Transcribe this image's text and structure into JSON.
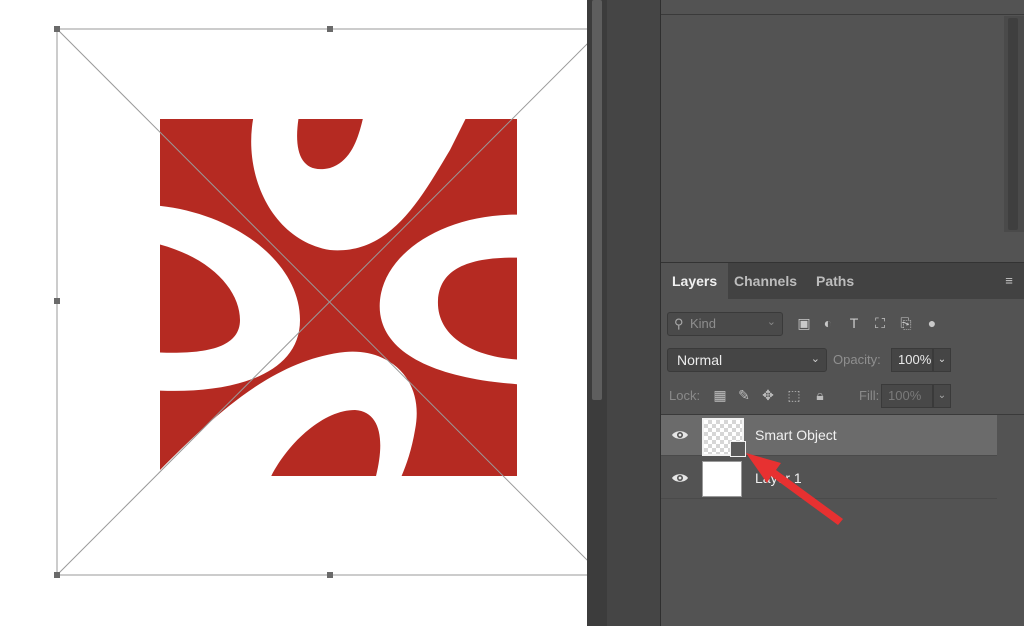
{
  "colors": {
    "artwork_red": "#b52a22",
    "annotation_arrow": "#e73131",
    "panel_bg": "#535353",
    "selected_row": "#6b6b6b"
  },
  "canvas": {
    "artwork": "red square with white abstract curved shapes",
    "transform_box": "free-transform bounding box with handles"
  },
  "layers_panel": {
    "tabs": [
      {
        "label": "Layers",
        "active": true
      },
      {
        "label": "Channels",
        "active": false
      },
      {
        "label": "Paths",
        "active": false
      }
    ],
    "menu_icon": "hamburger-icon",
    "filter": {
      "placeholder": "Kind",
      "icons": [
        "image-filter-icon",
        "adjustment-filter-icon",
        "type-filter-icon",
        "shape-filter-icon",
        "smart-object-filter-icon",
        "toggle-filter-icon"
      ]
    },
    "blend_mode": "Normal",
    "opacity_label": "Opacity:",
    "opacity_value": "100%",
    "lock_label": "Lock:",
    "lock_icons": [
      "lock-transparent-icon",
      "lock-image-icon",
      "lock-position-icon",
      "lock-artboard-icon",
      "lock-all-icon"
    ],
    "fill_label": "Fill:",
    "fill_value": "100%",
    "layers": [
      {
        "name": "Smart Object",
        "selected": true,
        "visible": true,
        "thumbnail": "checker"
      },
      {
        "name": "Layer 1",
        "selected": false,
        "visible": true,
        "thumbnail": "white"
      }
    ]
  }
}
